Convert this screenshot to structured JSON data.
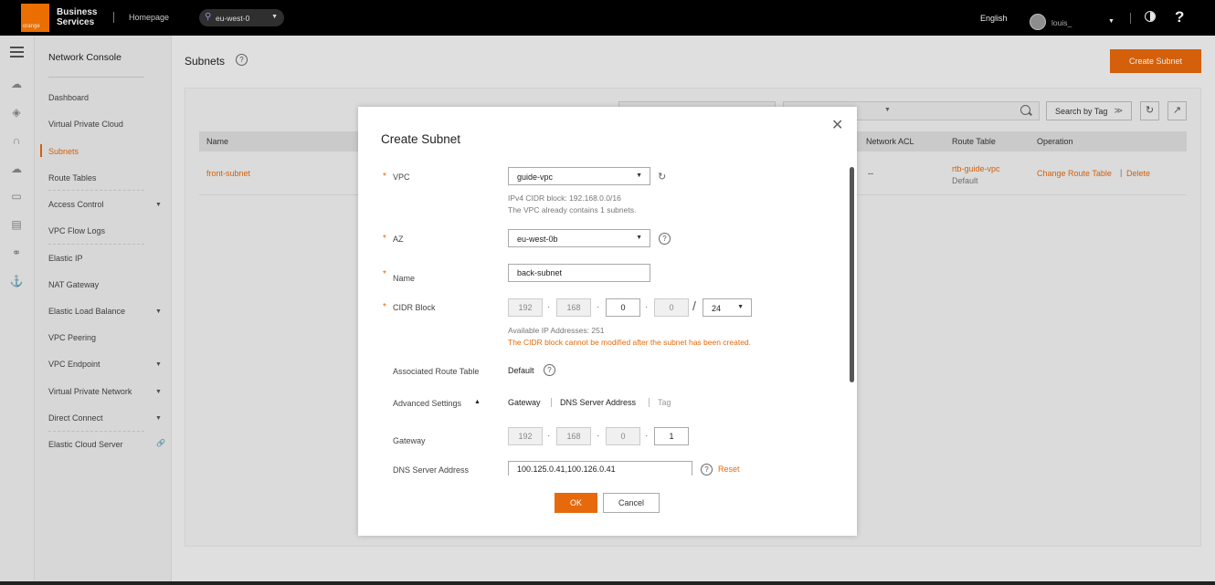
{
  "topbar": {
    "logo_text": "orange",
    "brand_line1": "Business",
    "brand_line2": "Services",
    "homepage": "Homepage",
    "region": "eu-west-0",
    "language": "English",
    "user": "louis_"
  },
  "sidebar": {
    "title": "Network Console",
    "items": [
      {
        "label": "Dashboard"
      },
      {
        "label": "Virtual Private Cloud"
      },
      {
        "label": "Subnets"
      },
      {
        "label": "Route Tables"
      },
      {
        "label": "Access Control"
      },
      {
        "label": "VPC Flow Logs"
      },
      {
        "label": "Elastic IP"
      },
      {
        "label": "NAT Gateway"
      },
      {
        "label": "Elastic Load Balance"
      },
      {
        "label": "VPC Peering"
      },
      {
        "label": "VPC Endpoint"
      },
      {
        "label": "Virtual Private Network"
      },
      {
        "label": "Direct Connect"
      },
      {
        "label": "Elastic Cloud Server"
      }
    ]
  },
  "main": {
    "title": "Subnets",
    "create_button": "Create Subnet",
    "search_by_tag": "Search by Tag",
    "table": {
      "headers": [
        "Name",
        "Network ACL",
        "Route Table",
        "Operation"
      ],
      "rows": [
        {
          "name": "front-subnet",
          "network_acl": "--",
          "route_table": "rtb-guide-vpc",
          "route_table_sub": "Default",
          "op_change": "Change Route Table",
          "op_delete": "Delete"
        }
      ]
    }
  },
  "modal": {
    "title": "Create Subnet",
    "vpc": {
      "label": "VPC",
      "value": "guide-vpc",
      "hint1": "IPv4 CIDR block: 192.168.0.0/16",
      "hint2": "The VPC already contains 1 subnets."
    },
    "az": {
      "label": "AZ",
      "value": "eu-west-0b"
    },
    "name": {
      "label": "Name",
      "value": "back-subnet"
    },
    "cidr": {
      "label": "CIDR Block",
      "o1": "192",
      "o2": "168",
      "o3": "0",
      "o4": "0",
      "mask": "24",
      "available": "Available IP Addresses: 251",
      "warning": "The CIDR block cannot be modified after the subnet has been created."
    },
    "route_table": {
      "label": "Associated Route Table",
      "value": "Default"
    },
    "advanced": {
      "label": "Advanced Settings",
      "tabs": [
        "Gateway",
        "DNS Server Address",
        "Tag"
      ]
    },
    "gateway": {
      "label": "Gateway",
      "o1": "192",
      "o2": "168",
      "o3": "0",
      "o4": "1"
    },
    "dns": {
      "label": "DNS Server Address",
      "value": "100.125.0.41,100.126.0.41",
      "reset": "Reset"
    },
    "ok": "OK",
    "cancel": "Cancel"
  },
  "colors": {
    "accent": "#e6690c",
    "topbar": "#000000"
  }
}
